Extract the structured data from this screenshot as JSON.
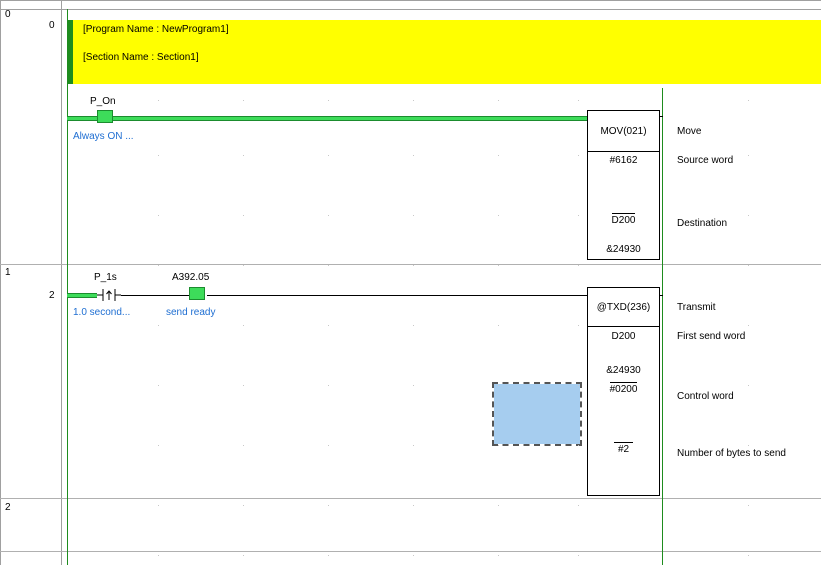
{
  "rungs": [
    {
      "index": "0",
      "step": "0",
      "comment_program": "[Program Name : NewProgram1]",
      "comment_section": "[Section Name : Section1]",
      "contact": {
        "name": "P_On",
        "comment": "Always ON ..."
      },
      "instruction": {
        "mnemonic": "MOV(021)",
        "description": "Move",
        "operands": [
          {
            "value": "#6162",
            "description": "Source word"
          },
          {
            "value": "D200",
            "description": "Destination"
          },
          {
            "value": "&24930",
            "description": ""
          }
        ]
      }
    },
    {
      "index": "1",
      "step": "2",
      "contacts": [
        {
          "name": "P_1s",
          "comment": "1.0 second..."
        },
        {
          "name": "A392.05",
          "comment": "send ready"
        }
      ],
      "instruction": {
        "mnemonic": "@TXD(236)",
        "description": "Transmit",
        "operands": [
          {
            "value": "D200",
            "description": "First send word"
          },
          {
            "value": "&24930",
            "description": ""
          },
          {
            "value": "#0200",
            "description": "Control word"
          },
          {
            "value": "#2",
            "description": "Number of bytes to send"
          }
        ]
      }
    },
    {
      "index": "2"
    }
  ],
  "colors": {
    "power_rail": "#1e8c1e",
    "energized": "#3ddc5a",
    "comment_bg": "#ffff00",
    "selection": "#a6cdef",
    "comment_text": "#1e6ed2"
  }
}
